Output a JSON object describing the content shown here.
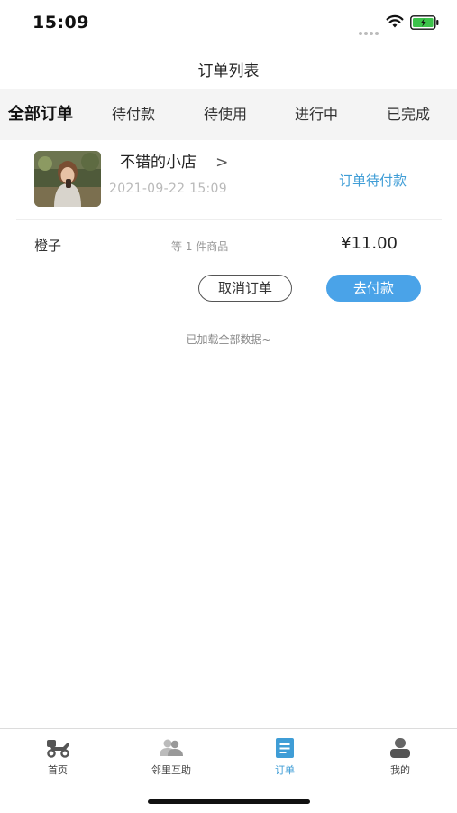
{
  "status_bar": {
    "time": "15:09"
  },
  "header": {
    "title": "订单列表"
  },
  "tabs": [
    {
      "label": "全部订单",
      "active": true
    },
    {
      "label": "待付款",
      "active": false
    },
    {
      "label": "待使用",
      "active": false
    },
    {
      "label": "进行中",
      "active": false
    },
    {
      "label": "已完成",
      "active": false
    }
  ],
  "order": {
    "shop_name": "不错的小店",
    "chevron": ">",
    "time": "2021-09-22 15:09",
    "status": "订单待付款",
    "item_name": "橙子",
    "item_count": "等 1 件商品",
    "price": "¥11.00",
    "cancel_label": "取消订单",
    "pay_label": "去付款"
  },
  "list": {
    "load_hint": "已加载全部数据~"
  },
  "bottom_nav": [
    {
      "label": "首页",
      "icon": "scooter-icon"
    },
    {
      "label": "邻里互助",
      "icon": "people-icon"
    },
    {
      "label": "订单",
      "icon": "order-icon",
      "active": true
    },
    {
      "label": "我的",
      "icon": "user-icon"
    }
  ],
  "colors": {
    "accent": "#3f9dd6",
    "pay_button": "#4aa3e8",
    "tab_bar_bg": "#f4f4f4"
  }
}
